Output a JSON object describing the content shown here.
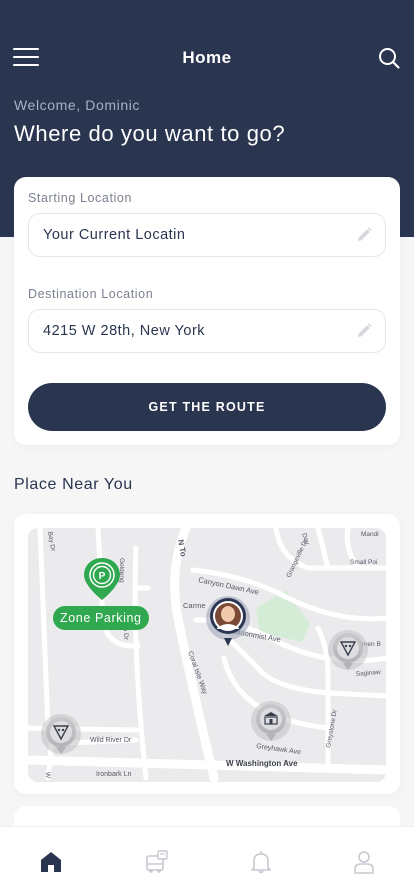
{
  "header": {
    "title": "Home",
    "welcome": "Welcome, Dominic",
    "headline": "Where do you want to go?"
  },
  "route_form": {
    "start_label": "Starting Location",
    "start_value": "Your Current Locatin",
    "destination_label": "Destination Location",
    "destination_value": "4215 W 28th, New York",
    "button_label": "GET THE ROUTE"
  },
  "nearby": {
    "title": "Place Near You"
  },
  "map": {
    "parking_label": "Zone Parking",
    "streets": [
      "N To",
      "Canyon Dawn Ave",
      "Carme",
      "Moonmist Ave",
      "Coral Isle Way",
      "Goldeng",
      "Tanton Dr",
      "Wild River Dr",
      "Ironbark Ln",
      "W Washington Ave",
      "Greyhawk Ave",
      "Greystone Dr",
      "Grangeville Dr",
      "Small Poi",
      "Mandi",
      "men B",
      "Saginaw",
      "Day",
      "Bay Dr"
    ]
  },
  "nav": {
    "items": [
      "home-icon",
      "bus-icon",
      "bell-icon",
      "profile-icon"
    ]
  },
  "colors": {
    "navy": "#2a3550",
    "parking_green": "#2fa84f",
    "park_green": "#d4ecd6"
  }
}
